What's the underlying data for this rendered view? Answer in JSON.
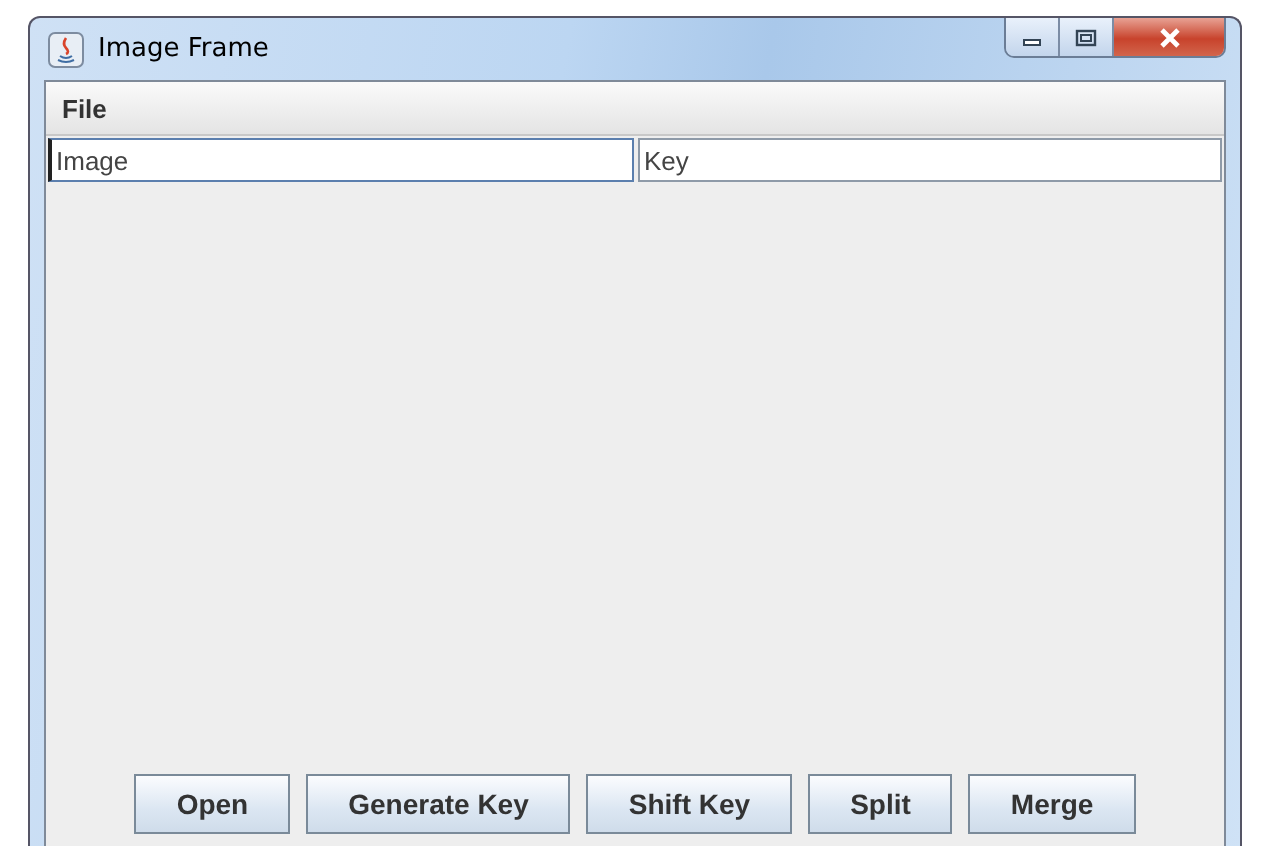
{
  "window": {
    "title": "Image Frame"
  },
  "menu": [
    {
      "label": "File"
    }
  ],
  "fields": [
    {
      "value": "Image",
      "focused": true
    },
    {
      "value": "Key",
      "focused": false
    }
  ],
  "buttons": [
    "Open",
    "Generate Key",
    "Shift Key",
    "Split",
    "Merge"
  ]
}
